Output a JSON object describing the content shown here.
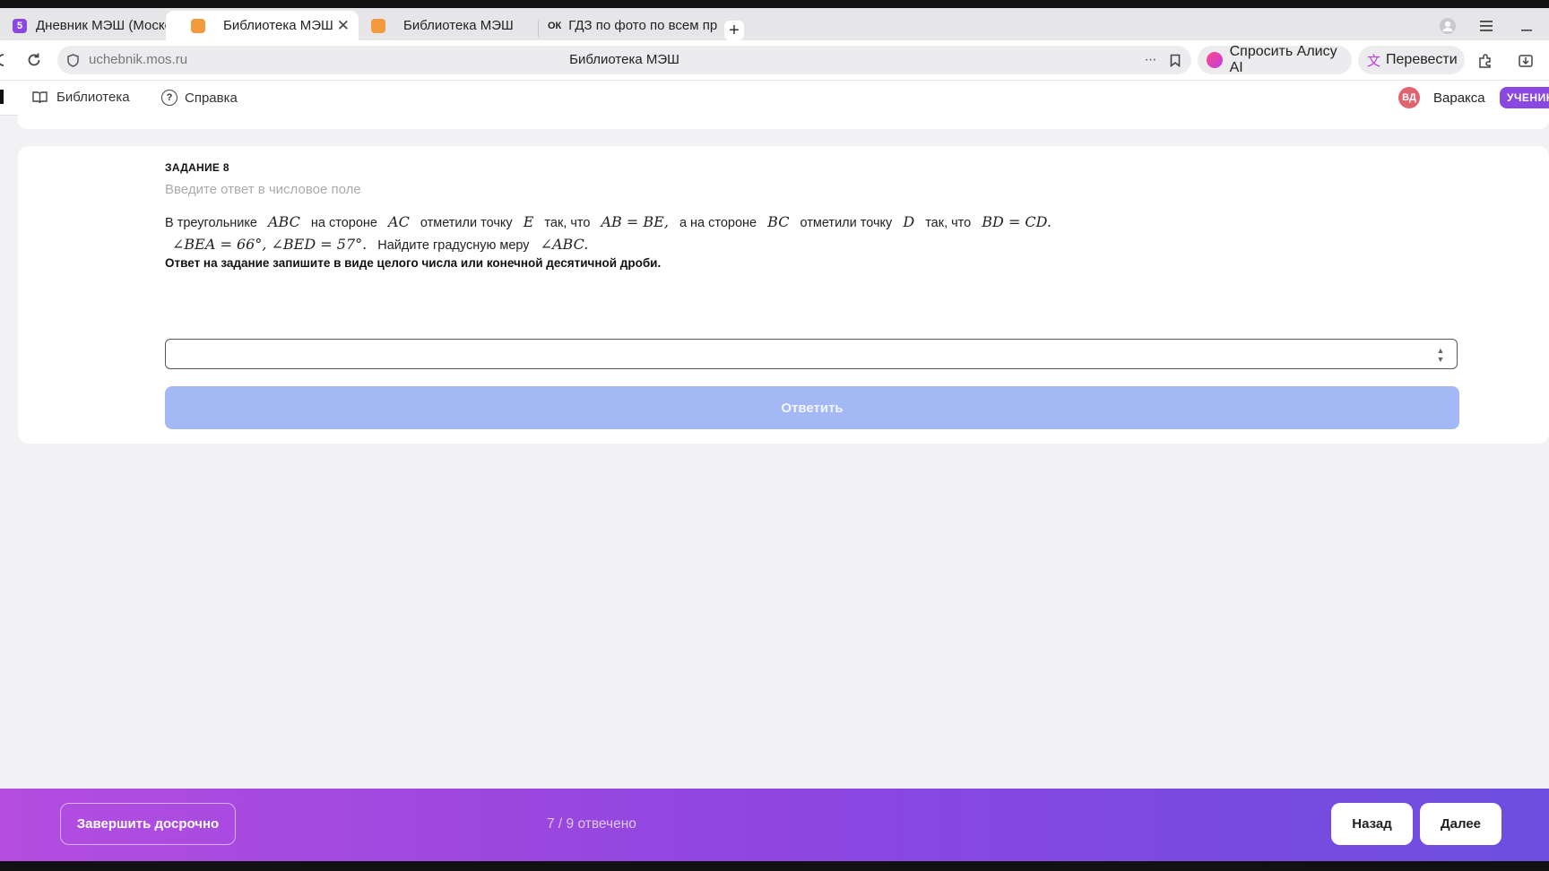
{
  "browser": {
    "tabs": [
      {
        "label": "Дневник МЭШ (Московск",
        "favicon": "5",
        "favicon_color": "#8a48e0"
      },
      {
        "label": "Библиотека МЭШ",
        "favicon": "",
        "favicon_color": "#f29a3c",
        "active": true
      },
      {
        "label": "Библиотека МЭШ",
        "favicon": "",
        "favicon_color": "#f29a3c"
      },
      {
        "label": "ГДЗ по фото по всем пред",
        "favicon": "ОК",
        "favicon_color": "#ffffff"
      }
    ],
    "url": "uchebnik.mos.ru",
    "page_title": "Библиотека МЭШ",
    "alice_label": "Спросить Алису AI",
    "translate_label": "Перевести"
  },
  "site_nav": {
    "library_label": "Библиотека",
    "help_label": "Справка",
    "user_initials": "ВД",
    "user_name": "Варакса",
    "role_badge": "УЧЕНИК"
  },
  "task": {
    "number_label": "ЗАДАНИЕ 8",
    "hint": "Введите ответ в числовое поле",
    "text": {
      "p1": "В треугольнике",
      "m1": "ABC",
      "p2": "на стороне",
      "m2": "AC",
      "p3": "отметили точку",
      "m3": "E",
      "p4": "так, что",
      "m4": "AB = BE,",
      "p5": "а на стороне",
      "m5": "BC",
      "p6": "отметили точку",
      "m6": "D",
      "p7": "так, что",
      "m7": "BD = CD.",
      "m8": "∠BEA = 66°, ∠BED = 57°.",
      "p8": "Найдите градусную меру",
      "m9": "∠ABC."
    },
    "note": "Ответ на задание запишите в виде целого числа или конечной десятичной дроби.",
    "answer_value": "",
    "submit_label": "Ответить"
  },
  "footer": {
    "finish_label": "Завершить досрочно",
    "progress_text": "7 / 9 отвечено",
    "back_label": "Назад",
    "next_label": "Далее"
  },
  "colors": {
    "accent_purple": "#8a48e0",
    "submit_disabled": "#a3b8f5",
    "footer_gradient_start": "#b44de0",
    "footer_gradient_end": "#6c4fe0"
  }
}
